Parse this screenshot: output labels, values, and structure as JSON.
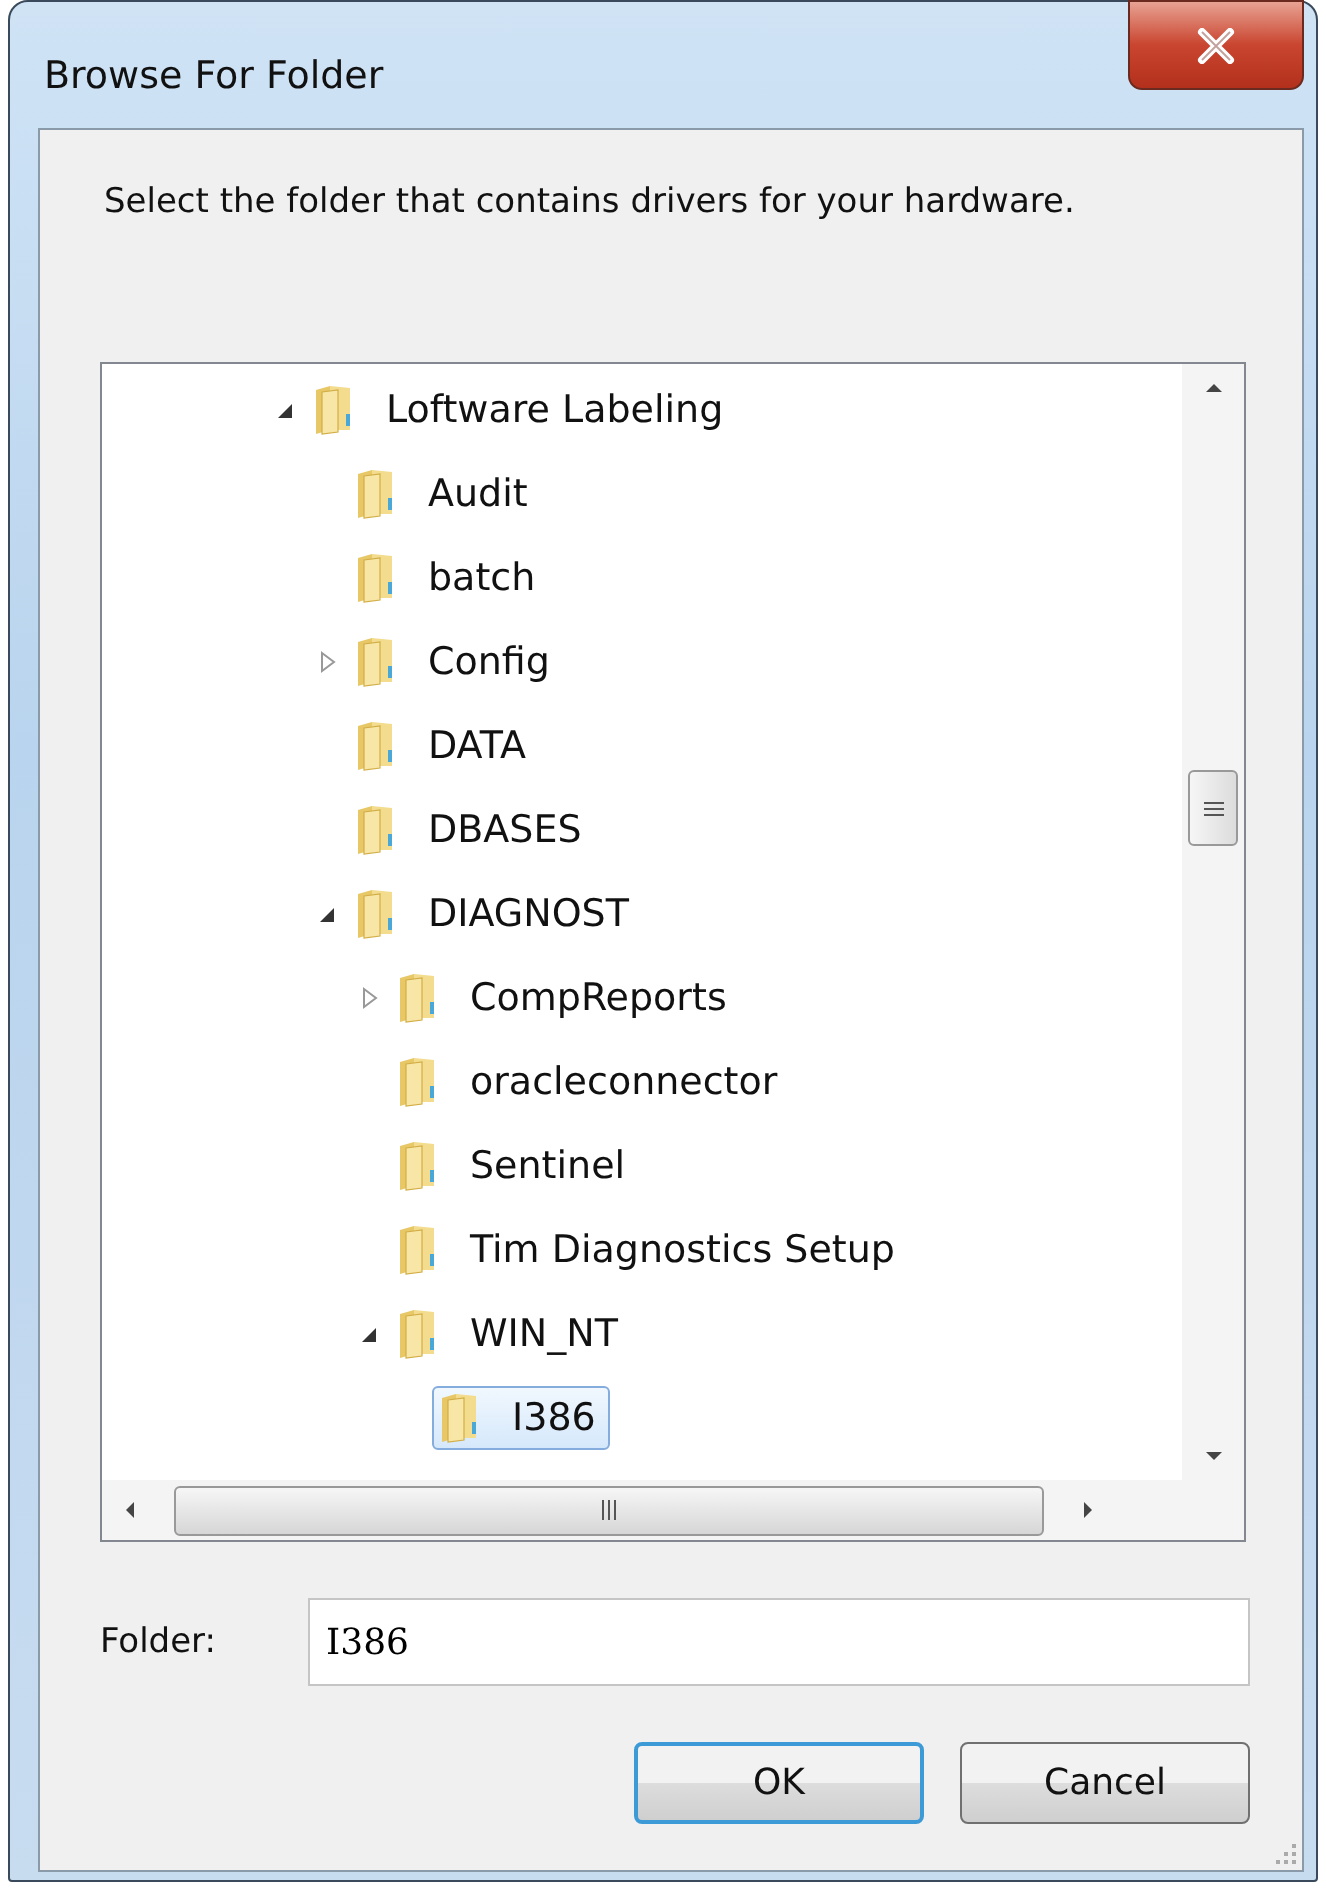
{
  "window": {
    "title": "Browse For Folder"
  },
  "instruction": "Select the folder that contains drivers for your hardware.",
  "tree": {
    "items": [
      {
        "label": "Loftware Labeling",
        "expanded": true,
        "selected": false,
        "children": [
          {
            "label": "Audit",
            "selected": false
          },
          {
            "label": "batch",
            "selected": false
          },
          {
            "label": "Config",
            "expanded": false,
            "selected": false
          },
          {
            "label": "DATA",
            "selected": false
          },
          {
            "label": "DBASES",
            "selected": false
          },
          {
            "label": "DIAGNOST",
            "expanded": true,
            "selected": false,
            "children": [
              {
                "label": "CompReports",
                "expanded": false,
                "selected": false
              },
              {
                "label": "oracleconnector",
                "selected": false
              },
              {
                "label": "Sentinel",
                "selected": false
              },
              {
                "label": "Tim Diagnostics Setup",
                "selected": false
              },
              {
                "label": "WIN_NT",
                "expanded": true,
                "selected": false,
                "children": [
                  {
                    "label": "I386",
                    "selected": true
                  }
                ]
              }
            ]
          }
        ]
      }
    ]
  },
  "folder_field": {
    "label": "Folder:",
    "value": "I386"
  },
  "buttons": [
    {
      "label": "OK",
      "default": true
    },
    {
      "label": "Cancel",
      "default": false
    }
  ]
}
